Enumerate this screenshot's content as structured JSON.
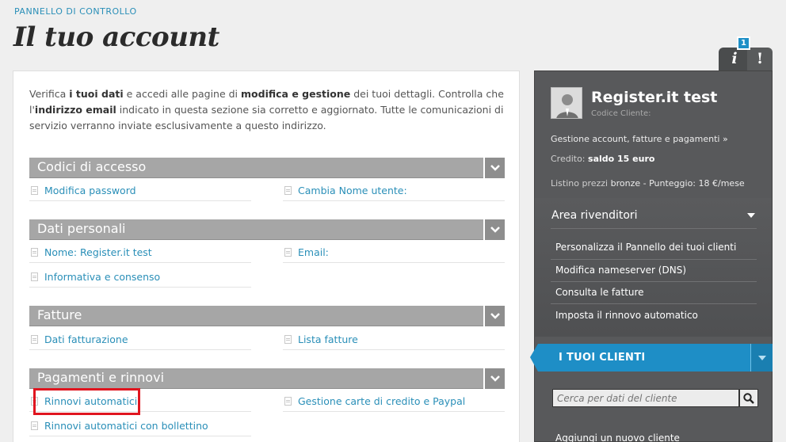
{
  "header": {
    "breadcrumb": "PANNELLO DI CONTROLLO",
    "title": "Il tuo account"
  },
  "intro": {
    "p1": "Verifica ",
    "b1": "i tuoi dati",
    "p2": " e accedi alle pagine di ",
    "b2": "modifica e gestione",
    "p3": " dei tuoi dettagli. Controlla che l'",
    "b3": "indirizzo email",
    "p4": " indicato in questa sezione sia corretto e aggiornato. Tutte le comunicazioni di servizio verranno inviate esclusivamente a questo indirizzo."
  },
  "sections": [
    {
      "title": "Codici di accesso",
      "items": [
        "Modifica password",
        "Cambia Nome utente:"
      ]
    },
    {
      "title": "Dati personali",
      "items": [
        "Nome: Register.it test",
        "Email:",
        "Informativa e consenso"
      ]
    },
    {
      "title": "Fatture",
      "items": [
        "Dati fatturazione",
        "Lista fatture"
      ]
    },
    {
      "title": "Pagamenti e rinnovi",
      "items": [
        "Rinnovi automatici",
        "Gestione carte di credito e Paypal",
        "Rinnovi automatici con bollettino"
      ]
    }
  ],
  "tabs": {
    "info_glyph": "i",
    "alert_glyph": "!",
    "badge_count": "1"
  },
  "sidebar": {
    "user_name": "Register.it test",
    "client_code_label": "Codice Cliente:",
    "account_link": "Gestione account, fatture e pagamenti »",
    "credit_label": "Credito: ",
    "credit_value": "saldo 15 euro",
    "pricelist_label": "Listino prezzi ",
    "pricelist_value": "bronze - Punteggio: 18 €/mese",
    "reseller_title": "Area rivenditori",
    "reseller_items": [
      "Personalizza il Pannello dei tuoi clienti",
      "Modifica nameserver (DNS)",
      "Consulta le fatture",
      "Imposta il rinnovo automatico"
    ],
    "clients_title": "I TUOI CLIENTI",
    "search_placeholder": "Cerca per dati del cliente",
    "add_client": "Aggiungi un nuovo cliente"
  },
  "colors": {
    "accent": "#1e8ec6",
    "link": "#2a8fb8",
    "section_header": "#a6a6a6",
    "highlight": "#e0151f"
  }
}
